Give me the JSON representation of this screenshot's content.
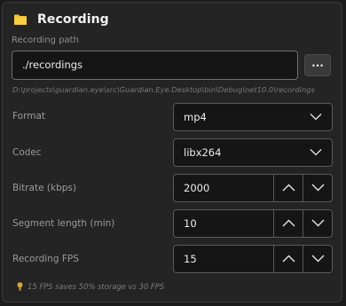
{
  "header": {
    "title": "Recording",
    "icon": "folder-icon",
    "icon_color": "#f2c12e"
  },
  "recording_path": {
    "label": "Recording path",
    "value": "./recordings",
    "browse_label": "...",
    "full_path": "D:\\projects\\guardian.eye\\src\\Guardian.Eye.Desktop\\bin\\Debug\\net10.0\\recordings"
  },
  "format": {
    "label": "Format",
    "value": "mp4"
  },
  "codec": {
    "label": "Codec",
    "value": "libx264"
  },
  "bitrate": {
    "label": "Bitrate (kbps)",
    "value": "2000"
  },
  "segment_length": {
    "label": "Segment length (min)",
    "value": "10"
  },
  "recording_fps": {
    "label": "Recording FPS",
    "value": "15"
  },
  "tip": {
    "icon": "lightbulb-icon",
    "text": "15 FPS saves 50% storage vs 30 FPS"
  }
}
